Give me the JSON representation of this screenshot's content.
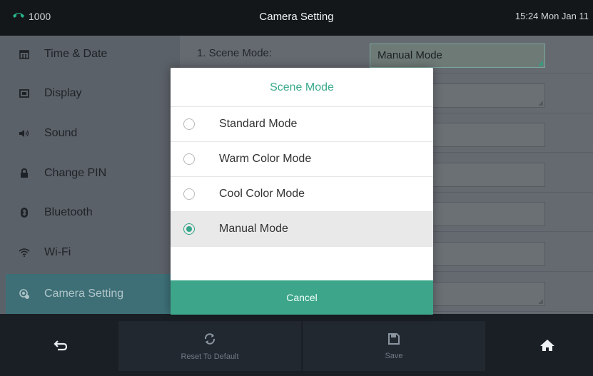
{
  "status_bar": {
    "line_label": "1000",
    "title": "Camera Setting",
    "datetime": "15:24 Mon Jan 11"
  },
  "sidebar": {
    "items": [
      {
        "label": "Time & Date",
        "icon": "calendar-icon"
      },
      {
        "label": "Display",
        "icon": "display-icon"
      },
      {
        "label": "Sound",
        "icon": "speaker-icon"
      },
      {
        "label": "Change PIN",
        "icon": "lock-icon"
      },
      {
        "label": "Bluetooth",
        "icon": "bluetooth-icon"
      },
      {
        "label": "Wi-Fi",
        "icon": "wifi-icon"
      },
      {
        "label": "Camera Setting",
        "icon": "camera-setting-icon",
        "active": true
      }
    ]
  },
  "settings": {
    "rows": [
      {
        "label": "1. Scene Mode:",
        "value": "Manual Mode"
      },
      {
        "label": "",
        "value": ""
      },
      {
        "label": "",
        "value": ""
      },
      {
        "label": "",
        "value": ""
      },
      {
        "label": "",
        "value": ""
      },
      {
        "label": "",
        "value": ""
      },
      {
        "label": "",
        "value": ""
      }
    ]
  },
  "dialog": {
    "title": "Scene Mode",
    "options": [
      {
        "label": "Standard Mode",
        "selected": false
      },
      {
        "label": "Warm Color Mode",
        "selected": false
      },
      {
        "label": "Cool Color Mode",
        "selected": false
      },
      {
        "label": "Manual Mode",
        "selected": true
      }
    ],
    "cancel_label": "Cancel"
  },
  "bottom_bar": {
    "back": {
      "icon": "back-arrow-icon"
    },
    "reset": {
      "label": "Reset To Default",
      "icon": "reset-icon"
    },
    "save": {
      "label": "Save",
      "icon": "save-icon"
    },
    "home": {
      "icon": "home-icon"
    }
  },
  "colors": {
    "accent": "#3da589",
    "status_bar": "#14171a",
    "sidebar_active": "#3e6f77"
  }
}
